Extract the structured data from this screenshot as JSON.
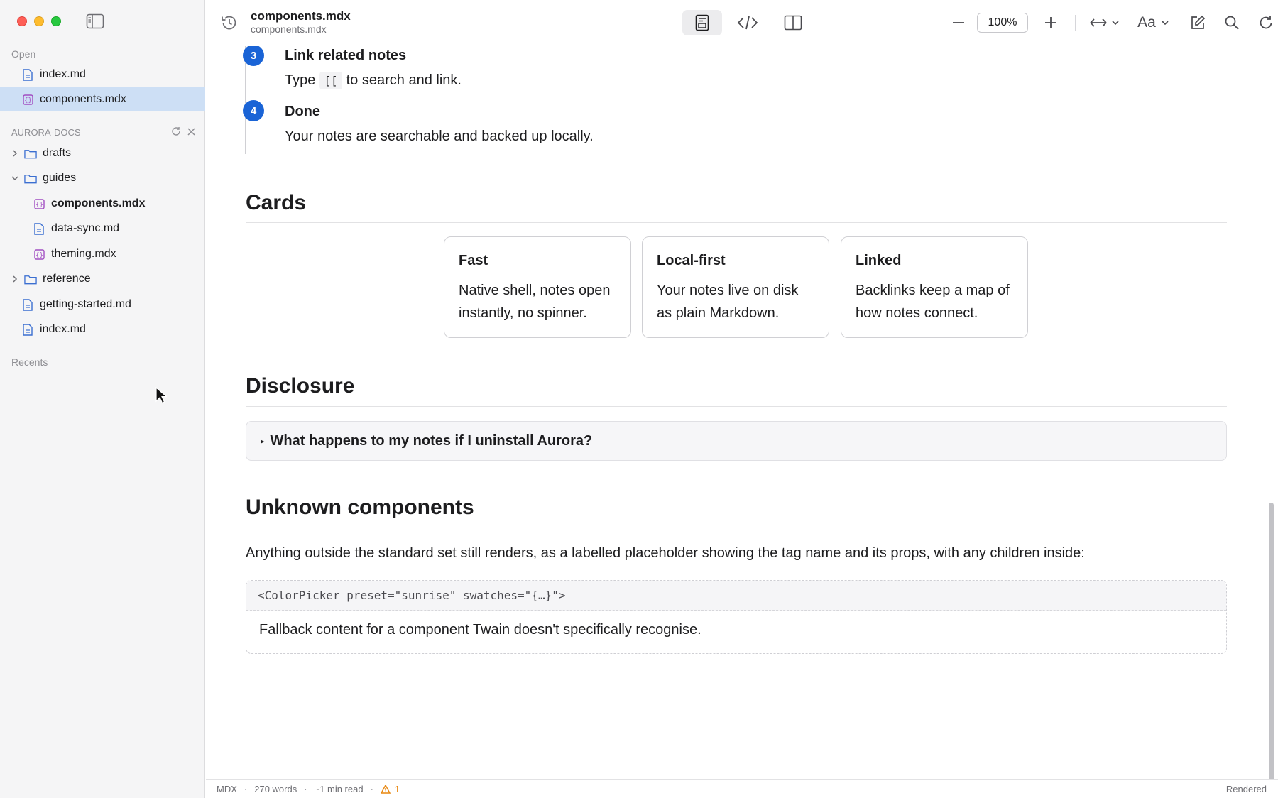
{
  "sidebar": {
    "open_label": "Open",
    "open_files": [
      {
        "label": "index.md",
        "type": "md"
      },
      {
        "label": "components.mdx",
        "type": "mdx",
        "selected": true
      }
    ],
    "repo_label": "AURORA-DOCS",
    "tree": {
      "drafts": "drafts",
      "guides": "guides",
      "components": "components.mdx",
      "data_sync": "data-sync.md",
      "theming": "theming.mdx",
      "reference": "reference",
      "getting_started": "getting-started.md",
      "index": "index.md"
    },
    "recents_label": "Recents"
  },
  "toolbar": {
    "title": "components.mdx",
    "subtitle": "components.mdx",
    "zoom": "100%",
    "font_button": "Aa"
  },
  "content": {
    "steps": [
      {
        "num": "3",
        "title": "Link related notes",
        "body_pre": "Type",
        "body_code": "[[",
        "body_post": "to search and link."
      },
      {
        "num": "4",
        "title": "Done",
        "body": "Your notes are searchable and backed up locally."
      }
    ],
    "cards_heading": "Cards",
    "cards": [
      {
        "title": "Fast",
        "body": "Native shell, notes open instantly, no spinner."
      },
      {
        "title": "Local-first",
        "body": "Your notes live on disk as plain Markdown."
      },
      {
        "title": "Linked",
        "body": "Backlinks keep a map of how notes connect."
      }
    ],
    "disclosure_heading": "Disclosure",
    "disclosure_summary": "What happens to my notes if I uninstall Aurora?",
    "unknown_heading": "Unknown components",
    "unknown_para": "Anything outside the standard set still renders, as a labelled placeholder showing the tag name and its props, with any children inside:",
    "placeholder_tag": "<ColorPicker preset=\"sunrise\" swatches=\"{…}\">",
    "placeholder_body": "Fallback content for a component Twain doesn't specifically recognise."
  },
  "statusbar": {
    "format": "MDX",
    "words": "270 words",
    "read_time": "~1 min read",
    "warnings": "1",
    "mode": "Rendered"
  },
  "colors": {
    "accent": "#1a64d6",
    "selection": "#cddff5",
    "mdx_icon": "#a24ec2",
    "md_icon": "#3b6fd1",
    "warning": "#e8870f"
  }
}
